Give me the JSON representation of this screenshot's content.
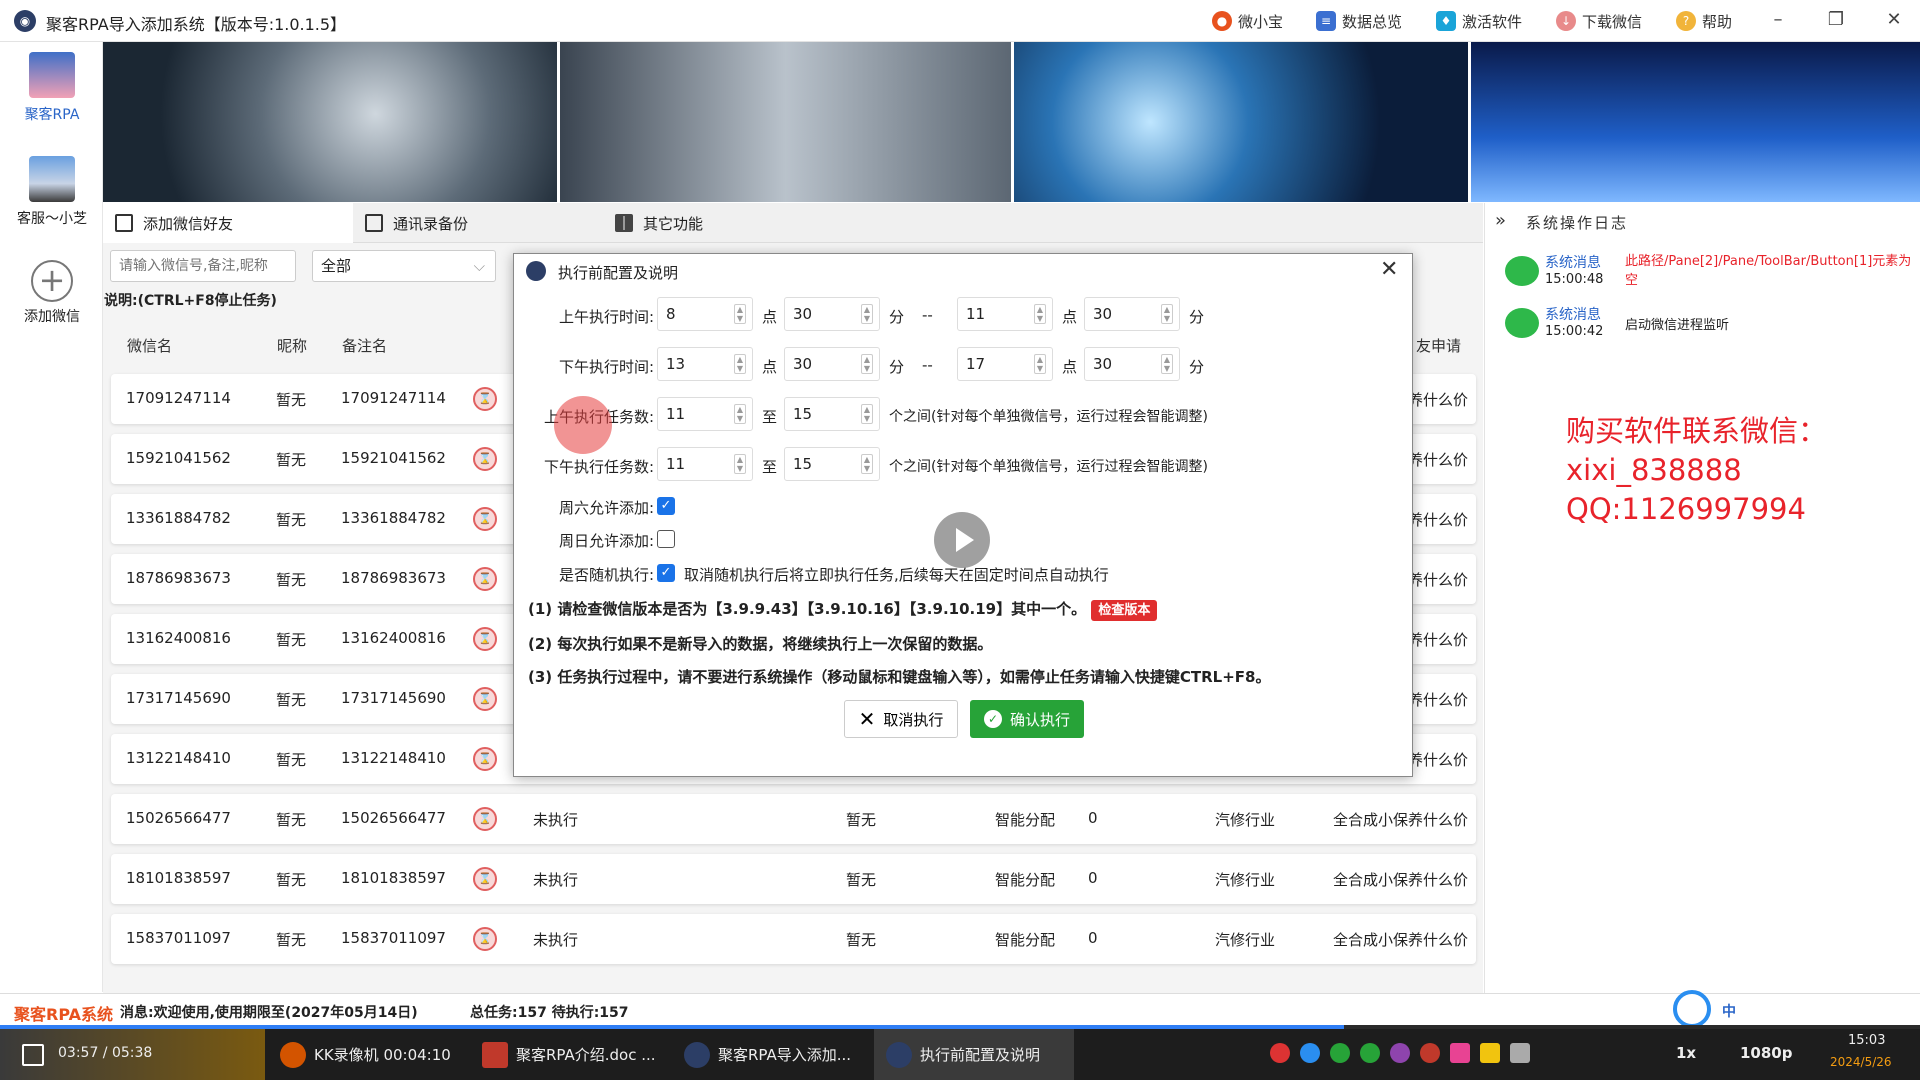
{
  "window": {
    "title": "聚客RPA导入添加系统【版本号:1.0.1.5】"
  },
  "topbar": {
    "items": [
      {
        "label": "微小宝",
        "icon": "user-icon"
      },
      {
        "label": "数据总览",
        "icon": "document-icon"
      },
      {
        "label": "激活软件",
        "icon": "shield-icon"
      },
      {
        "label": "下载微信",
        "icon": "download-icon"
      },
      {
        "label": "帮助",
        "icon": "help-icon"
      }
    ]
  },
  "rail": {
    "items": [
      {
        "label": "聚客RPA"
      },
      {
        "label": "客服～小芝"
      },
      {
        "label": "添加微信"
      }
    ]
  },
  "tabs": [
    {
      "label": "添加微信好友"
    },
    {
      "label": "通讯录备份"
    },
    {
      "label": "其它功能"
    }
  ],
  "search": {
    "placeholder": "请输入微信号,备注,昵称",
    "filter_value": "全部"
  },
  "hint": "说明:(CTRL+F8停止任务)",
  "table": {
    "columns": [
      "微信名",
      "昵称",
      "备注名"
    ],
    "right_header": "友申请",
    "rows": [
      {
        "wx": "17091247114",
        "nick": "暂无",
        "remark": "17091247114",
        "tail": "养什么价"
      },
      {
        "wx": "15921041562",
        "nick": "暂无",
        "remark": "15921041562",
        "tail": "养什么价"
      },
      {
        "wx": "13361884782",
        "nick": "暂无",
        "remark": "13361884782",
        "tail": "养什么价"
      },
      {
        "wx": "18786983673",
        "nick": "暂无",
        "remark": "18786983673",
        "tail": "养什么价"
      },
      {
        "wx": "13162400816",
        "nick": "暂无",
        "remark": "13162400816",
        "tail": "养什么价"
      },
      {
        "wx": "17317145690",
        "nick": "暂无",
        "remark": "17317145690",
        "tail": "养什么价"
      },
      {
        "wx": "13122148410",
        "nick": "暂无",
        "remark": "13122148410",
        "tail": "养什么价"
      },
      {
        "wx": "15026566477",
        "nick": "暂无",
        "remark": "15026566477",
        "status": "未执行",
        "c5": "暂无",
        "c6": "智能分配",
        "c7": "0",
        "c8": "汽修行业",
        "tail": "全合成小保养什么价"
      },
      {
        "wx": "18101838597",
        "nick": "暂无",
        "remark": "18101838597",
        "status": "未执行",
        "c5": "暂无",
        "c6": "智能分配",
        "c7": "0",
        "c8": "汽修行业",
        "tail": "全合成小保养什么价"
      },
      {
        "wx": "15837011097",
        "nick": "暂无",
        "remark": "15837011097",
        "status": "未执行",
        "c5": "暂无",
        "c6": "智能分配",
        "c7": "0",
        "c8": "汽修行业",
        "tail": "全合成小保养什么价"
      }
    ]
  },
  "log": {
    "title": "系统操作日志",
    "items": [
      {
        "source": "系统消息",
        "time": "15:00:48",
        "message": "此路径/Pane[2]/Pane/ToolBar/Button[1]元素为空",
        "color": "#e8232b"
      },
      {
        "source": "系统消息",
        "time": "15:00:42",
        "message": "启动微信进程监听",
        "color": "#222"
      }
    ]
  },
  "buy_info": {
    "line1": "购买软件联系微信：",
    "line2": "xixi_838888",
    "line3": "QQ:1126997994"
  },
  "status": {
    "brand": "聚客RPA系统",
    "message": "消息:欢迎使用,使用期限至(2027年05月14日)",
    "totals": "总任务:157 待执行:157"
  },
  "dialog": {
    "title": "执行前配置及说明",
    "am_time_label": "上午执行时间:",
    "pm_time_label": "下午执行时间:",
    "am_task_label": "上午执行任务数:",
    "pm_task_label": "下午执行任务数:",
    "am": {
      "h1": "8",
      "m1": "30",
      "h2": "11",
      "m2": "30"
    },
    "pm": {
      "h1": "13",
      "m1": "30",
      "h2": "17",
      "m2": "30"
    },
    "am_tasks": {
      "min": "11",
      "max": "15"
    },
    "pm_tasks": {
      "min": "11",
      "max": "15"
    },
    "unit_hour": "点",
    "unit_min": "分",
    "dash": "--",
    "to": "至",
    "task_note": "个之间(针对每个单独微信号，运行过程会智能调整)",
    "sat_label": "周六允许添加:",
    "sun_label": "周日允许添加:",
    "random_label": "是否随机执行:",
    "random_note": "取消随机执行后将立即执行任务,后续每天在固定时间点自动执行",
    "sat": true,
    "sun": false,
    "random": true,
    "note1": "(1) 请检查微信版本是否为【3.9.9.43】【3.9.10.16】【3.9.10.19】其中一个。",
    "check_version": "检查版本",
    "note2": "(2) 每次执行如果不是新导入的数据，将继续执行上一次保留的数据。",
    "note3": "(3) 任务执行过程中，请不要进行系统操作（移动鼠标和键盘输入等），如需停止任务请输入快捷键CTRL+F8。",
    "cancel": "取消执行",
    "confirm": "确认执行"
  },
  "player": {
    "time": "03:57 / 05:38",
    "progress": 0.7
  },
  "taskbar": {
    "tasks": [
      {
        "label": "KK录像机 00:04:10"
      },
      {
        "label": "聚客RPA介绍.doc ..."
      },
      {
        "label": "聚客RPA导入添加..."
      },
      {
        "label": "执行前配置及说明"
      }
    ],
    "ime": "中",
    "quality": "1080p",
    "speed": "1x",
    "clock": "15:03",
    "date": "2024/5/26"
  },
  "colors": {
    "accent": "#1a73e8",
    "danger": "#e02e2e",
    "success": "#27a338",
    "brand": "#e8521e"
  }
}
